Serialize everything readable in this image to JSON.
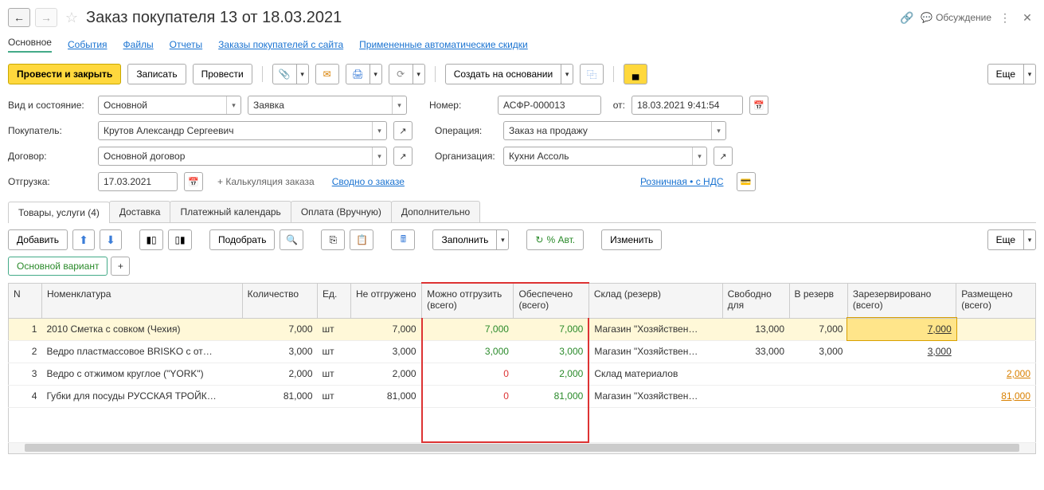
{
  "header": {
    "title": "Заказ покупателя 13 от 18.03.2021",
    "discuss": "Обсуждение"
  },
  "topTabs": {
    "main": "Основное",
    "events": "События",
    "files": "Файлы",
    "reports": "Отчеты",
    "siteOrders": "Заказы покупателей с сайта",
    "autoDiscounts": "Примененные автоматические скидки"
  },
  "toolbar": {
    "postClose": "Провести и закрыть",
    "save": "Записать",
    "post": "Провести",
    "createBased": "Создать на основании",
    "more": "Еще"
  },
  "form": {
    "typeStateLabel": "Вид и состояние:",
    "type": "Основной",
    "state": "Заявка",
    "numberLabel": "Номер:",
    "number": "АСФР-000013",
    "fromLabel": "от:",
    "date": "18.03.2021  9:41:54",
    "buyerLabel": "Покупатель:",
    "buyer": "Крутов Александр Сергеевич",
    "operationLabel": "Операция:",
    "operation": "Заказ на продажу",
    "contractLabel": "Договор:",
    "contract": "Основной договор",
    "orgLabel": "Организация:",
    "org": "Кухни Ассоль",
    "shipLabel": "Отгрузка:",
    "shipDate": "17.03.2021",
    "calcLink": "+ Калькуляция заказа",
    "summaryLink": "Сводно о заказе",
    "retailVat": "Розничная • с НДС"
  },
  "subTabs": {
    "goods": "Товары, услуги (4)",
    "delivery": "Доставка",
    "payCal": "Платежный календарь",
    "payment": "Оплата (Вручную)",
    "extra": "Дополнительно"
  },
  "tableToolbar": {
    "add": "Добавить",
    "pick": "Подобрать",
    "fill": "Заполнить",
    "autoPct": "% Авт.",
    "change": "Изменить",
    "more": "Еще",
    "mainVariant": "Основной вариант"
  },
  "columns": {
    "n": "N",
    "nomen": "Номенклатура",
    "qty": "Количество",
    "unit": "Ед.",
    "notShipped": "Не отгружено",
    "canShip": "Можно отгрузить (всего)",
    "secured": "Обеспечено (всего)",
    "warehouse": "Склад (резерв)",
    "freeFor": "Свободно для",
    "inReserve": "В резерв",
    "reserved": "Зарезервировано (всего)",
    "placed": "Размещено (всего)"
  },
  "rows": [
    {
      "n": "1",
      "nomen": "2010 Сметка с совком (Чехия)",
      "qty": "7,000",
      "unit": "шт",
      "notShipped": "7,000",
      "canShip": "7,000",
      "secured": "7,000",
      "warehouse": "Магазин \"Хозяйствен…",
      "freeFor": "13,000",
      "inReserve": "7,000",
      "reserved": "7,000",
      "placed": ""
    },
    {
      "n": "2",
      "nomen": "Ведро пластмассовое BRISKO с от…",
      "qty": "3,000",
      "unit": "шт",
      "notShipped": "3,000",
      "canShip": "3,000",
      "secured": "3,000",
      "warehouse": "Магазин \"Хозяйствен…",
      "freeFor": "33,000",
      "inReserve": "3,000",
      "reserved": "3,000",
      "placed": ""
    },
    {
      "n": "3",
      "nomen": "Ведро с отжимом  круглое (\"YORK\")",
      "qty": "2,000",
      "unit": "шт",
      "notShipped": "2,000",
      "canShip": "0",
      "secured": "2,000",
      "warehouse": "Склад материалов",
      "freeFor": "",
      "inReserve": "",
      "reserved": "",
      "placed": "2,000"
    },
    {
      "n": "4",
      "nomen": "Губки для посуды РУССКАЯ ТРОЙК…",
      "qty": "81,000",
      "unit": "шт",
      "notShipped": "81,000",
      "canShip": "0",
      "secured": "81,000",
      "warehouse": "Магазин \"Хозяйствен…",
      "freeFor": "",
      "inReserve": "",
      "reserved": "",
      "placed": "81,000"
    }
  ]
}
